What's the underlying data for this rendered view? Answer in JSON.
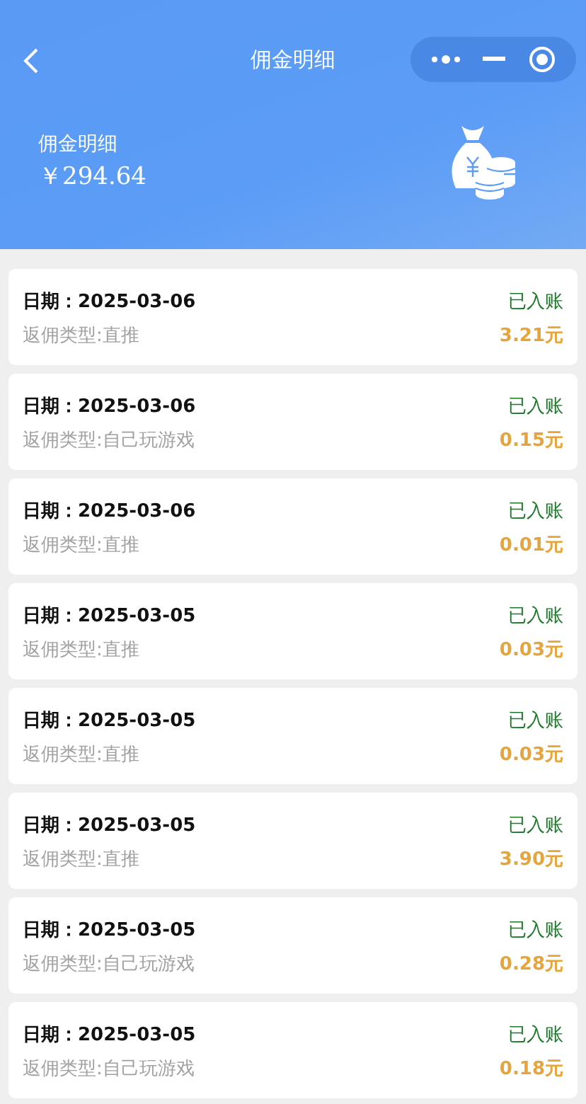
{
  "nav": {
    "title": "佣金明细"
  },
  "summary": {
    "label": "佣金明细",
    "amount": "￥294.64"
  },
  "records": [
    {
      "date": "日期：2025-03-06",
      "status": "已入账",
      "type": "返佣类型:直推",
      "amount": "3.21元"
    },
    {
      "date": "日期：2025-03-06",
      "status": "已入账",
      "type": "返佣类型:自己玩游戏",
      "amount": "0.15元"
    },
    {
      "date": "日期：2025-03-06",
      "status": "已入账",
      "type": "返佣类型:直推",
      "amount": "0.01元"
    },
    {
      "date": "日期：2025-03-05",
      "status": "已入账",
      "type": "返佣类型:直推",
      "amount": "0.03元"
    },
    {
      "date": "日期：2025-03-05",
      "status": "已入账",
      "type": "返佣类型:直推",
      "amount": "0.03元"
    },
    {
      "date": "日期：2025-03-05",
      "status": "已入账",
      "type": "返佣类型:直推",
      "amount": "3.90元"
    },
    {
      "date": "日期：2025-03-05",
      "status": "已入账",
      "type": "返佣类型:自己玩游戏",
      "amount": "0.28元"
    },
    {
      "date": "日期：2025-03-05",
      "status": "已入账",
      "type": "返佣类型:自己玩游戏",
      "amount": "0.18元"
    }
  ]
}
